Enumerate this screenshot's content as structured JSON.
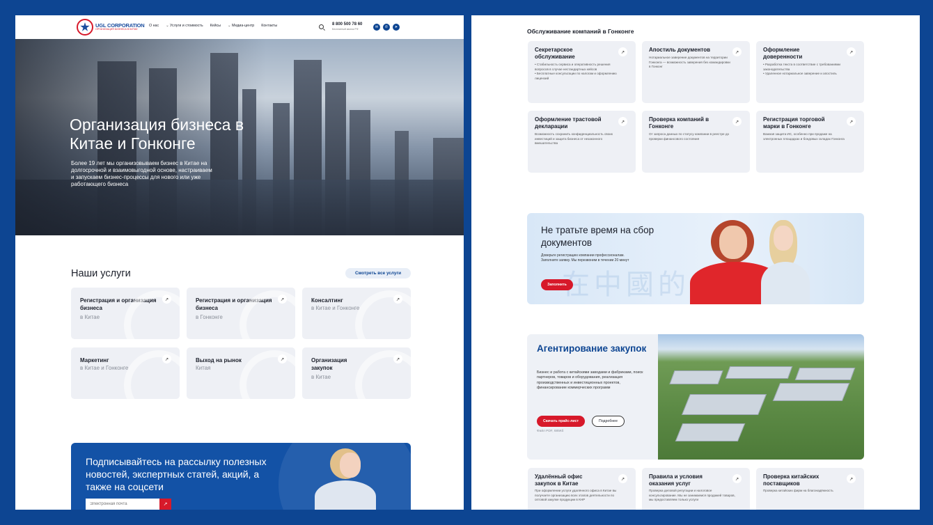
{
  "header": {
    "logo_name": "UGL CORPORATION",
    "logo_sub": "ОРГАНИЗАЦИЯ БИЗНЕСА В КИТАЕ",
    "nav": [
      "О нас",
      "Услуги и стоимость",
      "Кейсы",
      "Медиа-центр",
      "Контакты"
    ],
    "phone": "8 800 500 78 60",
    "phone_sub": "Бесплатный звонок РФ"
  },
  "hero": {
    "title": "Организация бизнеса в Китае и Гонконге",
    "text": "Более 19 лет мы организовываем бизнес в Китае на долгосрочной и взаимовыгодной основе, настраиваем и запускаем бизнес-процессы для нового или уже работающего бизнеса"
  },
  "services": {
    "title": "Наши услуги",
    "all_button": "Смотреть все услуги",
    "cards": [
      {
        "title": "Регистрация и организация бизнеса",
        "gray": "в Китае"
      },
      {
        "title": "Регистрация и организация бизнеса",
        "gray": "в Гонконге"
      },
      {
        "title": "Консалтинг",
        "gray": "в Китае и Гонконге"
      },
      {
        "title": "Маркетинг",
        "gray": "в Китае и Гонконге"
      },
      {
        "title": "Выход на рынок",
        "gray": "Китая"
      },
      {
        "title": "Организация закупок",
        "gray": "в Китае"
      }
    ]
  },
  "subscribe": {
    "title": "Подписывайтесь на рассылку полезных новостей, экспертных статей, акций, а также на соцсети",
    "placeholder": "Электронная почта",
    "button": "↗"
  },
  "hk": {
    "title": "Обслуживание компаний в Гонконге",
    "cards": [
      {
        "title": "Секретарское обслуживание",
        "desc": "• Стабильность сервиса и оперативность решения вопросов в случае нестандартных кейсов\n• Бесплатные консультации по налогам и оформлению лицензий"
      },
      {
        "title": "Апостиль документов",
        "desc": "Нотариальное заверение документов на территории Гонконга — возможность заверения без командировки в Гонконг"
      },
      {
        "title": "Оформление доверенности",
        "desc": "• Разработка текста в соответствие с требованиями законодательства\n• Удаленное нотариальное заверение и апостиль"
      },
      {
        "title": "Оформление трастовой декларации",
        "desc": "Возможность сохранить конфиденциальность своих инвестиций и защита бизнеса от незаконного вмешательства"
      },
      {
        "title": "Проверка компаний в Гонконге",
        "desc": "От запроса данных по статусу компании в реестре до проверки финансового состояния"
      },
      {
        "title": "Регистрация торговой марки в Гонконге",
        "desc": "Важная защита ИС, особенно при продаже на электронных площадках и бондовых складах Гонконга"
      }
    ]
  },
  "promo": {
    "title": "Не тратьте время на сбор документов",
    "text": "Доверьте регистрацию компании профессионалам. Заполните заявку. Мы перезвоним в течении 20 минут",
    "button": "Заполнить",
    "watermark": "在中國的 識"
  },
  "agent": {
    "title": "Агентирование закупок",
    "text": "Бизнес и работа с китайскими заводами и фабриками, поиск партнеров, товаров и оборудования, реализация производственных и инвестиционных проектов, финансирование коммерческих программ",
    "primary_button": "Скачать прайс-лист",
    "secondary_button": "Подробнее",
    "file": "Файл PDF, 685Кб"
  },
  "bottom_cards": [
    {
      "title": "Удалённый офис закупок в Китае",
      "desc": "При оформлении услуги удалённого офиса в Китае вы получаете организацию всех этапов деятельности по оптовой закупке продукции в КНР"
    },
    {
      "title": "Правила и условия оказания услуг",
      "desc": "Проверка деловой репутации и налоговое консультирование. Мы не занимаемся продажей товаров, мы предоставляем только услуги"
    },
    {
      "title": "Проверка китайских поставщиков",
      "desc": "Проверка китайских фирм на благонадёжность"
    }
  ],
  "colors": {
    "brand_blue": "#0d4592",
    "accent_red": "#d7192a",
    "card_bg": "#eef0f5"
  }
}
